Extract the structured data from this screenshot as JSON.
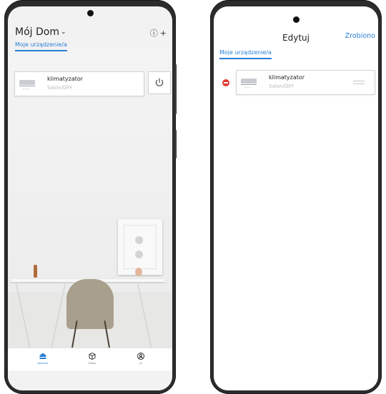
{
  "home": {
    "title": "Mój Dom",
    "help_icon": "question-circle-icon",
    "add_icon": "plus-icon",
    "tab_label": "Moje urządzenie/a",
    "device": {
      "name": "klimatyzator",
      "status": "Salon/OFF",
      "icon": "air-conditioner-icon"
    },
    "power_icon": "power-icon",
    "nav": [
      {
        "label": "Kontrola",
        "icon": "home-icon",
        "active": true
      },
      {
        "label": "Sceny",
        "icon": "cube-icon",
        "active": false
      },
      {
        "label": "Ja",
        "icon": "user-icon",
        "active": false
      }
    ]
  },
  "edit": {
    "title": "Edytuj",
    "done_label": "Zrobiono",
    "tab_label": "Moje urządzenie/a",
    "device": {
      "name": "klimatyzator",
      "status": "Salon/OFF",
      "icon": "air-conditioner-icon"
    },
    "delete_icon": "minus-circle-icon",
    "drag_icon": "drag-handle-icon"
  },
  "colors": {
    "accent": "#2a7fd4",
    "delete": "#e53935",
    "frame": "#2c2c2e"
  }
}
